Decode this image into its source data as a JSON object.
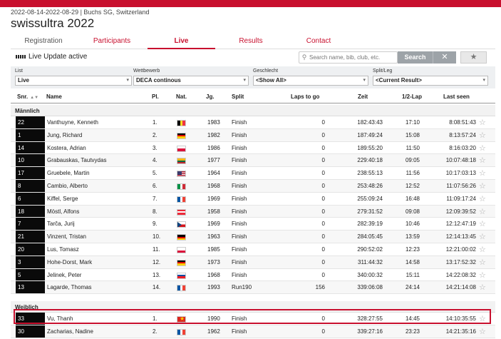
{
  "event": {
    "meta": "2022-08-14-2022-08-29 | Buchs SG, Switzerland",
    "title": "swissultra 2022"
  },
  "tabs": [
    {
      "label": "Registration",
      "active": false
    },
    {
      "label": "Participants",
      "active": false
    },
    {
      "label": "Live",
      "active": true
    },
    {
      "label": "Results",
      "active": false
    },
    {
      "label": "Contact",
      "active": false
    }
  ],
  "live_status": "Live Update active",
  "search": {
    "placeholder": "Search name, bib, club, etc.",
    "button_label": "Search",
    "clear_icon": "close-icon",
    "favorite_icon": "star-icon"
  },
  "filters": [
    {
      "label": "List",
      "value": "Live"
    },
    {
      "label": "Wettbewerb",
      "value": "DECA continous"
    },
    {
      "label": "Geschlecht",
      "value": "<Show All>"
    },
    {
      "label": "Split/Leg",
      "value": "<Current Result>"
    }
  ],
  "columns": {
    "snr": "Snr.",
    "name": "Name",
    "pl": "Pl.",
    "nat": "Nat.",
    "jg": "Jg.",
    "split": "Split",
    "laps": "Laps to go",
    "zeit": "Zeit",
    "lap": "1/2-Lap",
    "seen": "Last seen"
  },
  "colors": {
    "accent": "#c8102e",
    "snr_bg": "#0a0a0a",
    "highlight_border": "#c8102e"
  },
  "groups": [
    {
      "label": "Männlich",
      "rows": [
        {
          "snr": "22",
          "name": "Vanthuyne, Kenneth",
          "pl": "1.",
          "flag": "be",
          "jg": "1983",
          "split": "Finish",
          "laps": "0",
          "zeit": "182:43:43",
          "lap": "17:10",
          "seen": "8:08:51:43"
        },
        {
          "snr": "1",
          "name": "Jung, Richard",
          "pl": "2.",
          "flag": "de",
          "jg": "1982",
          "split": "Finish",
          "laps": "0",
          "zeit": "187:49:24",
          "lap": "15:08",
          "seen": "8:13:57:24"
        },
        {
          "snr": "14",
          "name": "Kostera, Adrian",
          "pl": "3.",
          "flag": "pl",
          "jg": "1986",
          "split": "Finish",
          "laps": "0",
          "zeit": "189:55:20",
          "lap": "11:50",
          "seen": "8:16:03:20"
        },
        {
          "snr": "10",
          "name": "Grabauskas, Tautvydas",
          "pl": "4.",
          "flag": "lt",
          "jg": "1977",
          "split": "Finish",
          "laps": "0",
          "zeit": "229:40:18",
          "lap": "09:05",
          "seen": "10:07:48:18"
        },
        {
          "snr": "17",
          "name": "Gruebele, Martin",
          "pl": "5.",
          "flag": "us",
          "jg": "1964",
          "split": "Finish",
          "laps": "0",
          "zeit": "238:55:13",
          "lap": "11:56",
          "seen": "10:17:03:13"
        },
        {
          "snr": "8",
          "name": "Cambio, Alberto",
          "pl": "6.",
          "flag": "it",
          "jg": "1968",
          "split": "Finish",
          "laps": "0",
          "zeit": "253:48:26",
          "lap": "12:52",
          "seen": "11:07:56:26"
        },
        {
          "snr": "6",
          "name": "Kiffel, Serge",
          "pl": "7.",
          "flag": "fr",
          "jg": "1969",
          "split": "Finish",
          "laps": "0",
          "zeit": "255:09:24",
          "lap": "16:48",
          "seen": "11:09:17:24"
        },
        {
          "snr": "18",
          "name": "Möstl, Alfons",
          "pl": "8.",
          "flag": "at",
          "jg": "1958",
          "split": "Finish",
          "laps": "0",
          "zeit": "279:31:52",
          "lap": "09:08",
          "seen": "12:09:39:52"
        },
        {
          "snr": "7",
          "name": "Tarča, Jurij",
          "pl": "9.",
          "flag": "cz",
          "jg": "1969",
          "split": "Finish",
          "laps": "0",
          "zeit": "282:39:19",
          "lap": "10:46",
          "seen": "12:12:47:19"
        },
        {
          "snr": "21",
          "name": "Vinzent, Tristan",
          "pl": "10.",
          "flag": "de",
          "jg": "1963",
          "split": "Finish",
          "laps": "0",
          "zeit": "284:05:45",
          "lap": "13:59",
          "seen": "12:14:13:45"
        },
        {
          "snr": "20",
          "name": "Lus, Tomasz",
          "pl": "11.",
          "flag": "pl",
          "jg": "1985",
          "split": "Finish",
          "laps": "0",
          "zeit": "290:52:02",
          "lap": "12:23",
          "seen": "12:21:00:02"
        },
        {
          "snr": "3",
          "name": "Hohe-Dorst, Mark",
          "pl": "12.",
          "flag": "de",
          "jg": "1973",
          "split": "Finish",
          "laps": "0",
          "zeit": "311:44:32",
          "lap": "14:58",
          "seen": "13:17:52:32"
        },
        {
          "snr": "5",
          "name": "Jelinek, Peter",
          "pl": "13.",
          "flag": "sk",
          "jg": "1968",
          "split": "Finish",
          "laps": "0",
          "zeit": "340:00:32",
          "lap": "15:11",
          "seen": "14:22:08:32"
        },
        {
          "snr": "13",
          "name": "Lagarde, Thomas",
          "pl": "14.",
          "flag": "fr",
          "jg": "1993",
          "split": "Run190",
          "laps": "156",
          "zeit": "339:06:08",
          "lap": "24:14",
          "seen": "14:21:14:08"
        }
      ]
    },
    {
      "label": "Weiblich",
      "rows": [
        {
          "snr": "33",
          "name": "Vu, Thanh",
          "pl": "1.",
          "flag": "vn",
          "jg": "1990",
          "split": "Finish",
          "laps": "0",
          "zeit": "328:27:55",
          "lap": "14:45",
          "seen": "14:10:35:55"
        },
        {
          "snr": "30",
          "name": "Zacharias, Nadine",
          "pl": "2.",
          "flag": "fr",
          "jg": "1962",
          "split": "Finish",
          "laps": "0",
          "zeit": "339:27:16",
          "lap": "23:23",
          "seen": "14:21:35:16"
        }
      ]
    }
  ]
}
